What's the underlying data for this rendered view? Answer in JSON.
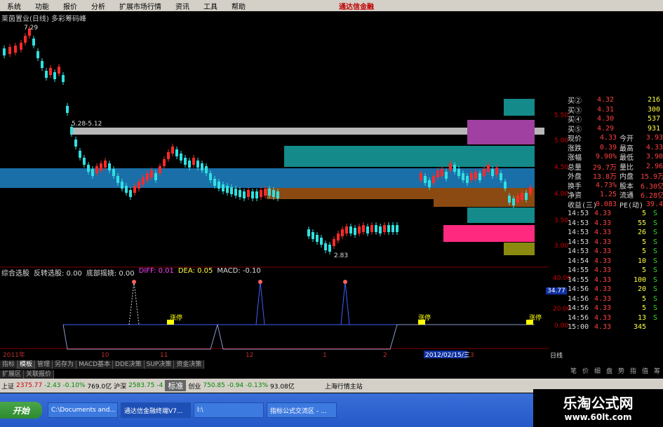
{
  "menu": [
    "系统",
    "功能",
    "报价",
    "分析",
    "扩展市场行情",
    "资讯",
    "工具",
    "帮助"
  ],
  "brand": "通达信金融",
  "chart_title": "莱茵置业(日线) 多彩筹码峰",
  "annotations": {
    "high": "7.29",
    "range": "5.28-5.12",
    "low": "2.83"
  },
  "indicator_strip": [
    "综合选股",
    "反转选股: 0.00",
    "底部摇娆: 0.00",
    "DIFF: 0.01",
    "DEA: 0.05",
    "MACD: -0.10"
  ],
  "ind_labels": [
    "涨停",
    "涨停",
    "涨停"
  ],
  "ind_axis": [
    "40.00",
    "20.00",
    "0.00"
  ],
  "ind_value": "34.77",
  "x_labels": [
    "2011年",
    "10",
    "11",
    "12",
    "1",
    "2",
    "2012/02/15/三",
    "3"
  ],
  "price_axis": [
    "5.50",
    "5.00",
    "4.50",
    "4.00",
    "3.50",
    "3.00"
  ],
  "period_label": "日线",
  "tabs_bottom": [
    "指标",
    "模板",
    "管理",
    "另存为",
    "MACD基本",
    "DDE决策",
    "SUP决策",
    "资金决策"
  ],
  "tabs_bottom2": [
    "扩展区",
    "关联报价"
  ],
  "quotes": {
    "book": [
      {
        "k": "买②",
        "p": "4.32",
        "v": "216"
      },
      {
        "k": "买③",
        "p": "4.31",
        "v": "300"
      },
      {
        "k": "买④",
        "p": "4.30",
        "v": "537"
      },
      {
        "k": "买⑤",
        "p": "4.29",
        "v": "931"
      }
    ],
    "stats": [
      {
        "a": "现价",
        "b": "4.33",
        "c": "今开",
        "d": "3.93"
      },
      {
        "a": "涨跌",
        "b": "0.39",
        "c": "最高",
        "d": "4.33"
      },
      {
        "a": "涨幅",
        "b": "9.90%",
        "c": "最低",
        "d": "3.90"
      },
      {
        "a": "总量",
        "b": "29.7万",
        "c": "量比",
        "d": "2.96"
      },
      {
        "a": "外盘",
        "b": "13.8万",
        "c": "内盘",
        "d": "15.9万"
      },
      {
        "a": "换手",
        "b": "4.73%",
        "c": "股本",
        "d": "6.30亿"
      },
      {
        "a": "净资",
        "b": "1.25",
        "c": "流通",
        "d": "6.28亿"
      },
      {
        "a": "收益(三)",
        "b": "0.083",
        "c": "PE(动)",
        "d": "39.4"
      }
    ],
    "ticks": [
      {
        "t": "14:53",
        "p": "4.33",
        "v": "5",
        "s": "S"
      },
      {
        "t": "14:53",
        "p": "4.33",
        "v": "55",
        "s": "S"
      },
      {
        "t": "14:53",
        "p": "4.33",
        "v": "26",
        "s": "S"
      },
      {
        "t": "14:53",
        "p": "4.33",
        "v": "5",
        "s": "S"
      },
      {
        "t": "14:53",
        "p": "4.33",
        "v": "5",
        "s": "S"
      },
      {
        "t": "14:54",
        "p": "4.33",
        "v": "10",
        "s": "S"
      },
      {
        "t": "14:55",
        "p": "4.33",
        "v": "5",
        "s": "S"
      },
      {
        "t": "14:55",
        "p": "4.33",
        "v": "100",
        "s": "S"
      },
      {
        "t": "14:56",
        "p": "4.33",
        "v": "20",
        "s": "S"
      },
      {
        "t": "14:56",
        "p": "4.33",
        "v": "5",
        "s": "S"
      },
      {
        "t": "14:56",
        "p": "4.33",
        "v": "5",
        "s": "S"
      },
      {
        "t": "14:56",
        "p": "4.33",
        "v": "13",
        "s": "S"
      },
      {
        "t": "15:00",
        "p": "4.33",
        "v": "345",
        "s": ""
      }
    ]
  },
  "right_tabs": [
    "笔",
    "价",
    "细",
    "盘",
    "势",
    "指",
    "值",
    "筹"
  ],
  "status": {
    "sh_label": "上证",
    "sh": "2375.77",
    "sh_chg": "-2.43",
    "sh_pct": "-0.10%",
    "sh_amt": "769.0亿",
    "hs_label": "沪深",
    "hs": "2583.75",
    "hs_chg": "-4",
    "std": "标准",
    "cy_label": "创业",
    "cy": "750.85",
    "cy_chg": "-0.94",
    "cy_pct": "-0.13%",
    "cy_amt": "93.08亿",
    "server": "上海行情主站"
  },
  "taskbar": {
    "start": "开始",
    "tasks": [
      "C:\\Documents and...",
      "通达信金融终端V7...",
      "I:\\",
      "指标公式交流区 - ..."
    ]
  },
  "watermark": {
    "l1": "乐淘公式网",
    "l2": "www.60lt.com"
  },
  "colors": {
    "up": "#ff2a2a",
    "down": "#30e0e0",
    "accent": "#ffff00",
    "magenta": "#ff40ff"
  }
}
